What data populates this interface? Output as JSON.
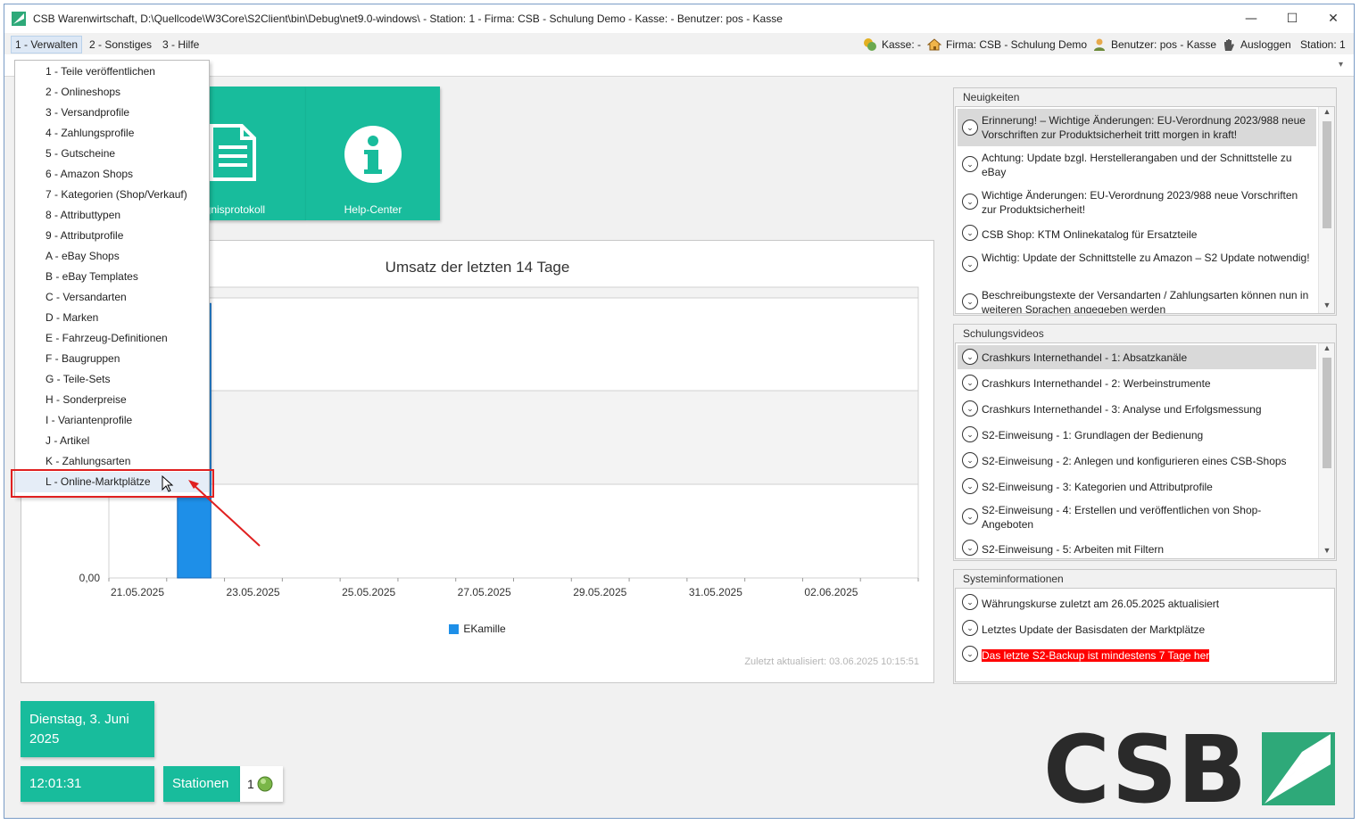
{
  "window": {
    "title": "CSB Warenwirtschaft, D:\\Quellcode\\W3Core\\S2Client\\bin\\Debug\\net9.0-windows\\ - Station: 1 - Firma: CSB - Schulung Demo - Kasse:  - Benutzer: pos - Kasse",
    "minimize": "—",
    "maximize": "☐",
    "close": "✕"
  },
  "menu": {
    "items": [
      "1 - Verwalten",
      "2 - Sonstiges",
      "3 - Hilfe"
    ]
  },
  "status": {
    "kasse": "Kasse: -",
    "firma": "Firma: CSB - Schulung Demo",
    "benutzer": "Benutzer: pos - Kasse",
    "ausloggen": "Ausloggen",
    "station": "Station: 1"
  },
  "dropdown": {
    "items": [
      "1 - Teile veröffentlichen",
      "2 - Onlineshops",
      "3 - Versandprofile",
      "4 - Zahlungsprofile",
      "5 - Gutscheine",
      "6 - Amazon Shops",
      "7 - Kategorien (Shop/Verkauf)",
      "8 - Attributtypen",
      "9 - Attributprofile",
      "A - eBay Shops",
      "B - eBay Templates",
      "C - Versandarten",
      "D - Marken",
      "E - Fahrzeug-Definitionen",
      "F - Baugruppen",
      "G - Teile-Sets",
      "H - Sonderpreise",
      "I - Variantenprofile",
      "J - Artikel",
      "K - Zahlungsarten",
      "L - Online-Marktplätze"
    ],
    "highlighted_index": 20
  },
  "tiles": {
    "ereignis": "Ereignisprotokoll",
    "ereignis_visible": "ignisprotokoll",
    "help": "Help-Center"
  },
  "chart_data": {
    "type": "bar",
    "title": "Umsatz der letzten 14 Tage",
    "x_tick_labels": [
      "21.05.2025",
      "23.05.2025",
      "25.05.2025",
      "27.05.2025",
      "29.05.2025",
      "31.05.2025",
      "02.06.2025"
    ],
    "y_tick_labels": [
      "0,00"
    ],
    "series": [
      {
        "name": "EKamille",
        "color": "#1e8fe8",
        "values": [
          {
            "x": "22.05.2025",
            "y_fraction_of_axis": 0.98
          }
        ]
      }
    ],
    "legend": "bottom-center",
    "grid": true,
    "footer": "Zuletzt aktualisiert: 03.06.2025 10:15:51"
  },
  "news": {
    "title": "Neuigkeiten",
    "items": [
      "Erinnerung! – Wichtige Änderungen: EU-Verordnung 2023/988 neue Vorschriften zur Produktsicherheit tritt morgen in kraft!",
      "Achtung: Update bzgl. Herstellerangaben und der Schnittstelle zu eBay",
      "Wichtige Änderungen: EU-Verordnung 2023/988 neue Vorschriften zur Produktsicherheit!",
      "CSB Shop: KTM Onlinekatalog für Ersatzteile",
      "Wichtig: Update der Schnittstelle zu Amazon – S2 Update notwendig!",
      "Beschreibungstexte der Versandarten / Zahlungsarten können nun in weiteren Sprachen angegeben werden"
    ]
  },
  "videos": {
    "title": "Schulungsvideos",
    "items": [
      "Crashkurs Internethandel - 1: Absatzkanäle",
      "Crashkurs Internethandel - 2: Werbeinstrumente",
      "Crashkurs Internethandel - 3: Analyse und Erfolgsmessung",
      "S2-Einweisung - 1: Grundlagen der Bedienung",
      "S2-Einweisung - 2: Anlegen und konfigurieren eines CSB-Shops",
      "S2-Einweisung - 3: Kategorien und Attributprofile",
      "S2-Einweisung - 4: Erstellen und veröffentlichen von Shop-Angeboten",
      "S2-Einweisung - 5: Arbeiten mit Filtern"
    ]
  },
  "sysinfo": {
    "title": "Systeminformationen",
    "items": [
      "Währungskurse zuletzt am 26.05.2025 aktualisiert",
      "Letztes Update der Basisdaten der Marktplätze",
      "Das letzte S2-Backup ist mindestens 7 Tage her"
    ],
    "alert_color": "#ff0000"
  },
  "footer": {
    "date": "Dienstag, 3. Juni 2025",
    "time": "12:01:31",
    "stationen": "Stationen",
    "station_count": "1",
    "logo": "CSB"
  },
  "colors": {
    "accent": "#18bc9c",
    "bar": "#1e8fe8",
    "highlight_box": "#e02020"
  }
}
